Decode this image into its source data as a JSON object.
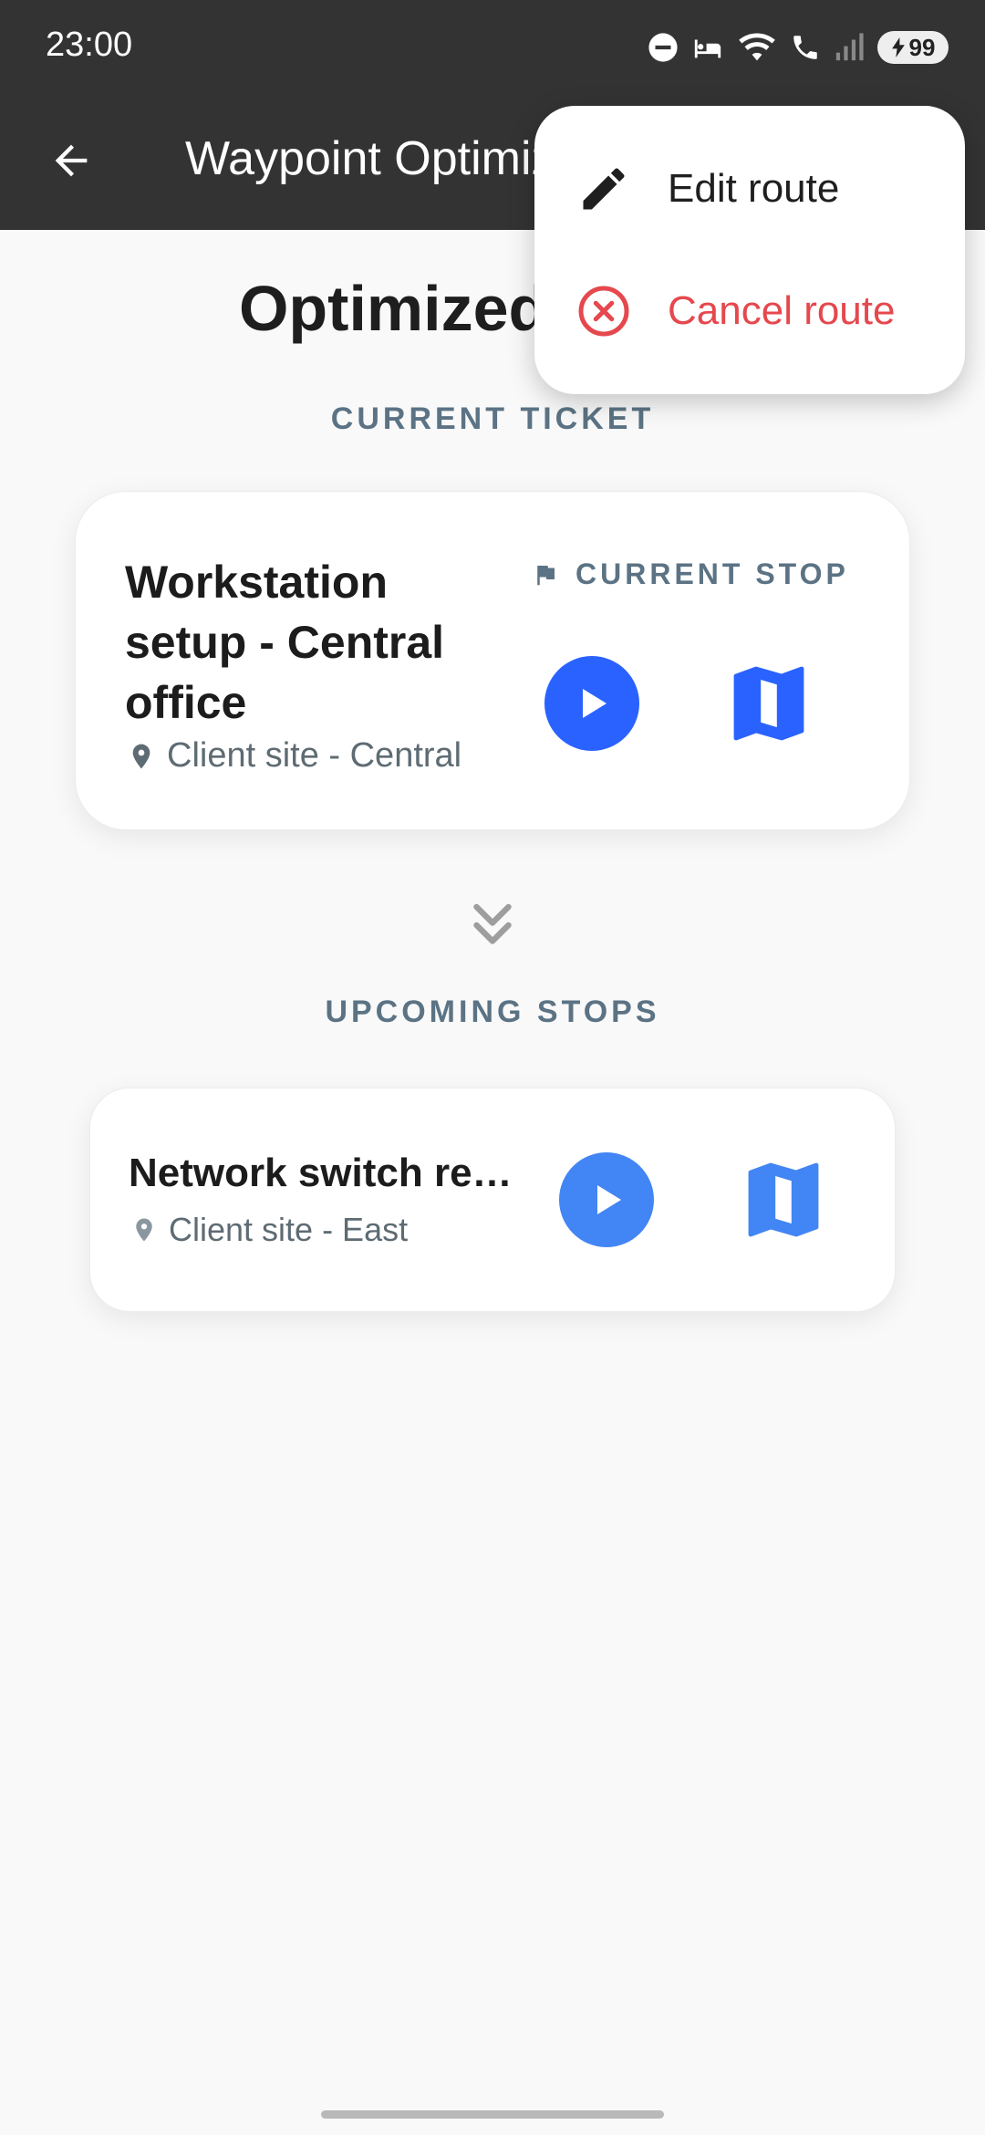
{
  "status_bar": {
    "time": "23:00",
    "battery": "99",
    "icons": [
      "do-not-disturb-icon",
      "sleep-icon",
      "wifi-icon",
      "wifi-call-icon",
      "signal-icon",
      "battery-icon"
    ]
  },
  "app_bar": {
    "title": "Waypoint Optimizer",
    "back_icon": "arrow-left-icon"
  },
  "main": {
    "heading": "Optimized Route",
    "current_section_label": "CURRENT TICKET",
    "upcoming_section_label": "UPCOMING STOPS",
    "current_ticket": {
      "title": "Workstation setup - Central office",
      "location": "Client site - Central",
      "badge": "CURRENT STOP",
      "play_icon": "play-icon",
      "map_icon": "map-icon"
    },
    "upcoming": [
      {
        "title": "Network switch re…",
        "location": "Client site - East",
        "play_icon": "play-icon",
        "map_icon": "map-icon"
      }
    ]
  },
  "menu": {
    "items": [
      {
        "label": "Edit route",
        "icon": "pencil-icon",
        "color": "#1f1f1f"
      },
      {
        "label": "Cancel route",
        "icon": "cancel-circle-icon",
        "color": "#e5484d"
      }
    ]
  },
  "colors": {
    "bar": "#333333",
    "accent_blue": "#2962ff",
    "accent_blue_light": "#4285f4",
    "label_grey": "#5b7384",
    "danger": "#e5484d"
  }
}
